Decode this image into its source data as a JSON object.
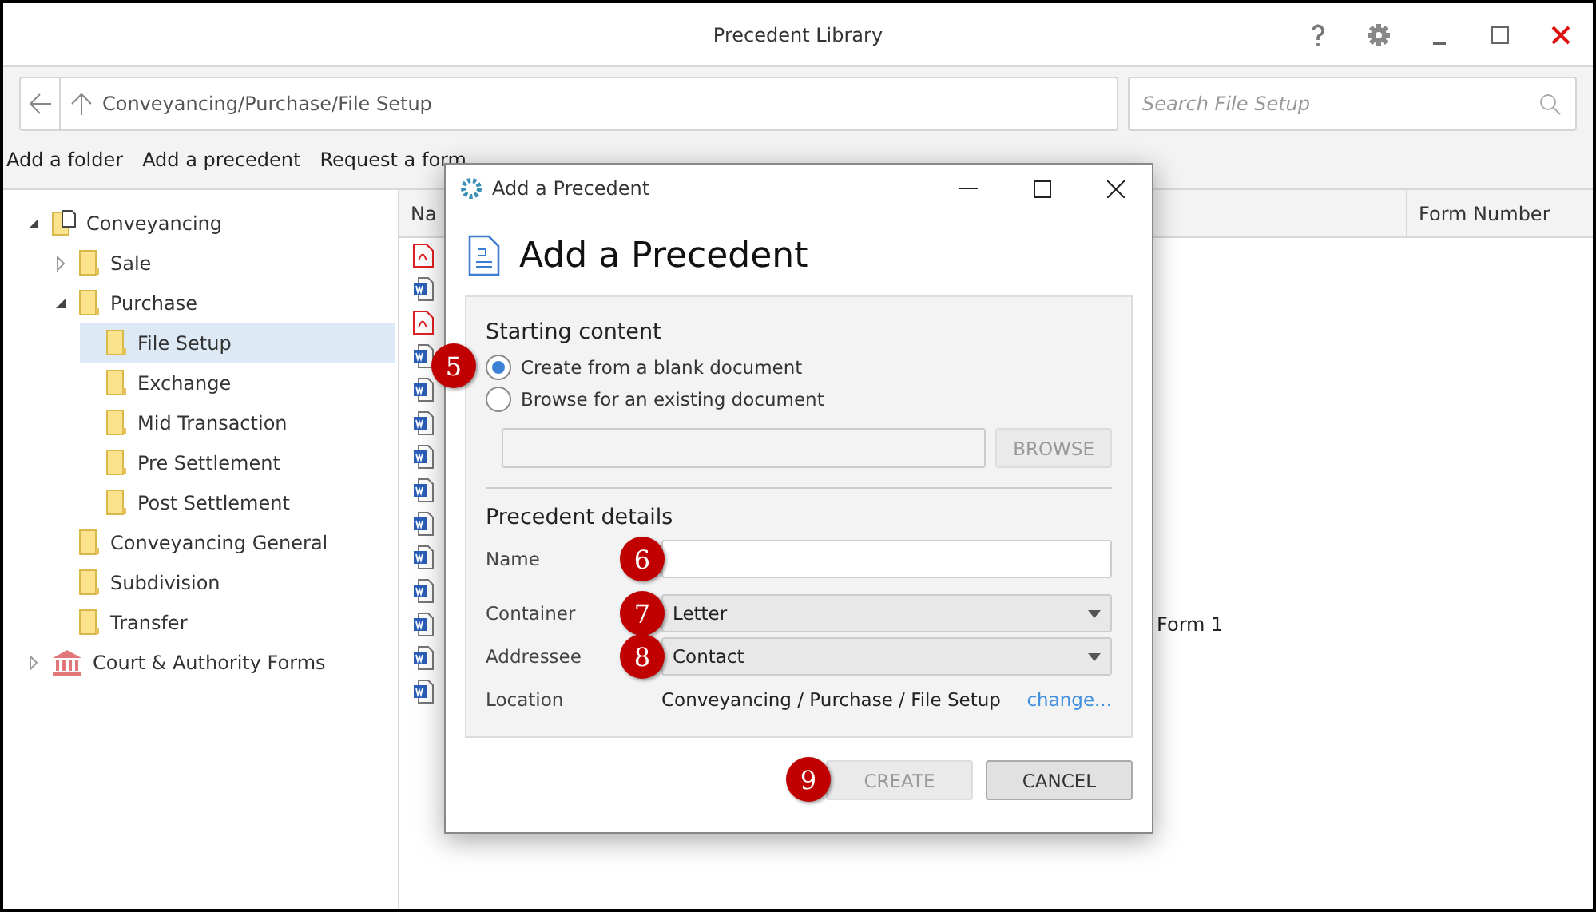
{
  "window": {
    "title": "Precedent Library"
  },
  "path": "Conveyancing/Purchase/File Setup",
  "search": {
    "placeholder": "Search File Setup"
  },
  "toolbar": [
    "Add a folder",
    "Add a precedent",
    "Request a form"
  ],
  "tree": [
    {
      "label": "Conveyancing",
      "kind": "root",
      "expanded": true,
      "selected": false,
      "children": [
        {
          "label": "Sale",
          "kind": "folder",
          "expanded": false,
          "selected": false
        },
        {
          "label": "Purchase",
          "kind": "folder",
          "expanded": true,
          "selected": false,
          "children": [
            {
              "label": "File Setup",
              "kind": "folder",
              "selected": true
            },
            {
              "label": "Exchange",
              "kind": "folder",
              "selected": false
            },
            {
              "label": "Mid Transaction",
              "kind": "folder",
              "selected": false
            },
            {
              "label": "Pre Settlement",
              "kind": "folder",
              "selected": false
            },
            {
              "label": "Post Settlement",
              "kind": "folder",
              "selected": false
            }
          ]
        },
        {
          "label": "Conveyancing General",
          "kind": "folder",
          "selected": false
        },
        {
          "label": "Subdivision",
          "kind": "folder",
          "selected": false
        },
        {
          "label": "Transfer",
          "kind": "folder",
          "selected": false
        }
      ]
    },
    {
      "label": "Court & Authority Forms",
      "kind": "court",
      "expanded": false,
      "selected": false
    }
  ],
  "table": {
    "columns": [
      "Na",
      "Form Number"
    ],
    "rows": [
      {
        "kind": "pdf"
      },
      {
        "kind": "word"
      },
      {
        "kind": "pdf"
      },
      {
        "kind": "word"
      },
      {
        "kind": "word"
      },
      {
        "kind": "word"
      },
      {
        "kind": "word"
      },
      {
        "kind": "word"
      },
      {
        "kind": "word"
      },
      {
        "kind": "word"
      },
      {
        "kind": "word"
      },
      {
        "kind": "word",
        "column_2": "Form 1"
      },
      {
        "kind": "word"
      },
      {
        "kind": "word"
      }
    ]
  },
  "dialog": {
    "title": "Add a Precedent",
    "heading": "Add a Precedent",
    "starting_section": "Starting content",
    "options": [
      {
        "label": "Create from a blank document",
        "selected": true,
        "callout": "5"
      },
      {
        "label": "Browse for an existing document",
        "selected": false
      }
    ],
    "browse_button": {
      "label": "BROWSE",
      "disabled": true
    },
    "details_section": "Precedent details",
    "name": {
      "label": "Name",
      "callout": "6"
    },
    "container": {
      "label": "Container",
      "value": "Letter",
      "callout": "7"
    },
    "addressee": {
      "label": "Addressee",
      "value": "Contact",
      "callout": "8"
    },
    "location": {
      "label": "Location",
      "value": "Conveyancing / Purchase / File Setup",
      "link": "change..."
    },
    "buttons": [
      {
        "label": "CREATE",
        "disabled": true,
        "callout": "9"
      },
      {
        "label": "CANCEL",
        "disabled": false
      }
    ]
  }
}
